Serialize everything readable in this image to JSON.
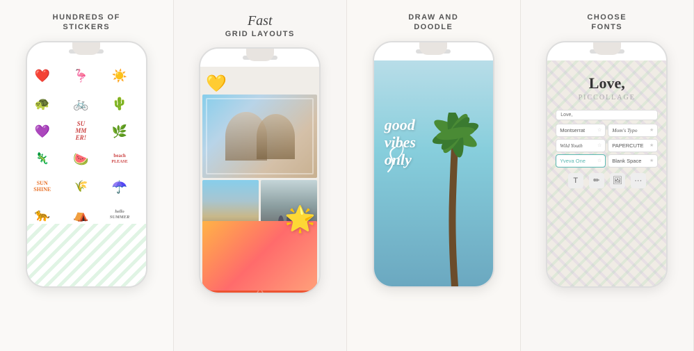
{
  "panels": [
    {
      "id": "stickers",
      "title_line1": "HUNDREDS OF",
      "title_line2": "STICKERS",
      "stickers": [
        {
          "emoji": "❤️"
        },
        {
          "emoji": "🦩"
        },
        {
          "emoji": "☀️"
        },
        {
          "emoji": "🐢"
        },
        {
          "emoji": "🚲"
        },
        {
          "emoji": "🌵"
        },
        {
          "emoji": "💜"
        },
        {
          "text": "SU MM ER!",
          "class": "st-summer"
        },
        {
          "emoji": "🌿"
        },
        {
          "emoji": "🦎"
        },
        {
          "emoji": "🍉"
        },
        {
          "text": "beach PLEASE",
          "class": "st-beach"
        },
        {
          "text": "SUN SHINE",
          "class": "st-sun"
        },
        {
          "emoji": "🌾"
        },
        {
          "emoji": "☂️"
        },
        {
          "emoji": "🐆"
        },
        {
          "emoji": "⛺"
        },
        {
          "text": "hello SUMMER",
          "class": "st-summer"
        }
      ]
    },
    {
      "id": "grid",
      "title_script": "Fast",
      "title_line2": "GRID LAYOUTS"
    },
    {
      "id": "draw",
      "title_line1": "DRAW AND",
      "title_line2": "DOODLE",
      "doodle_text": "good vibes only"
    },
    {
      "id": "fonts",
      "title_line1": "CHOOSE",
      "title_line2": "FONTS",
      "main_text": "Love,",
      "sub_text": "PICCOLLAGE",
      "input_placeholder": "Love,",
      "font_options": [
        {
          "name": "Montserrat",
          "star": false
        },
        {
          "name": "Mom's Typo",
          "star": true
        },
        {
          "name": "Wild Youth",
          "star": false
        },
        {
          "name": "PAPERCUTE",
          "star": true
        },
        {
          "name": "Yveva One",
          "selected": true,
          "star": false
        },
        {
          "name": "Blank Space",
          "star": true
        }
      ],
      "toolbar_icons": [
        "T",
        "✏️",
        "🖼"
      ]
    }
  ]
}
